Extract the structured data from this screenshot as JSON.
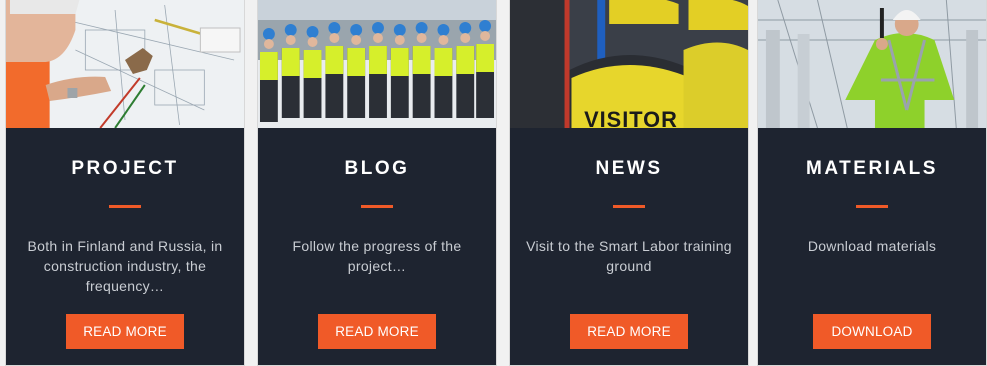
{
  "cards": [
    {
      "title": "PROJECT",
      "description": "Both in Finland and Russia, in construction industry, the frequency…",
      "button_label": "READ MORE",
      "image_subject": "architect drawing blueprints"
    },
    {
      "title": "BLOG",
      "description": "Follow the progress of the project…",
      "button_label": "READ MORE",
      "image_subject": "group of people in high-visibility vests and hard hats"
    },
    {
      "title": "NEWS",
      "description": "Visit to the Smart Labor training ground",
      "button_label": "READ MORE",
      "image_subject": "workers in yellow visitor vests",
      "image_text": "VISITOR"
    },
    {
      "title": "MATERIALS",
      "description": "Download materials",
      "button_label": "DOWNLOAD",
      "image_subject": "construction worker in safety harness"
    }
  ],
  "colors": {
    "card_background": "#1e2430",
    "accent": "#f05a28",
    "title_text": "#ffffff",
    "description_text": "#c9cdd3",
    "page_background": "#f1f1f1"
  }
}
